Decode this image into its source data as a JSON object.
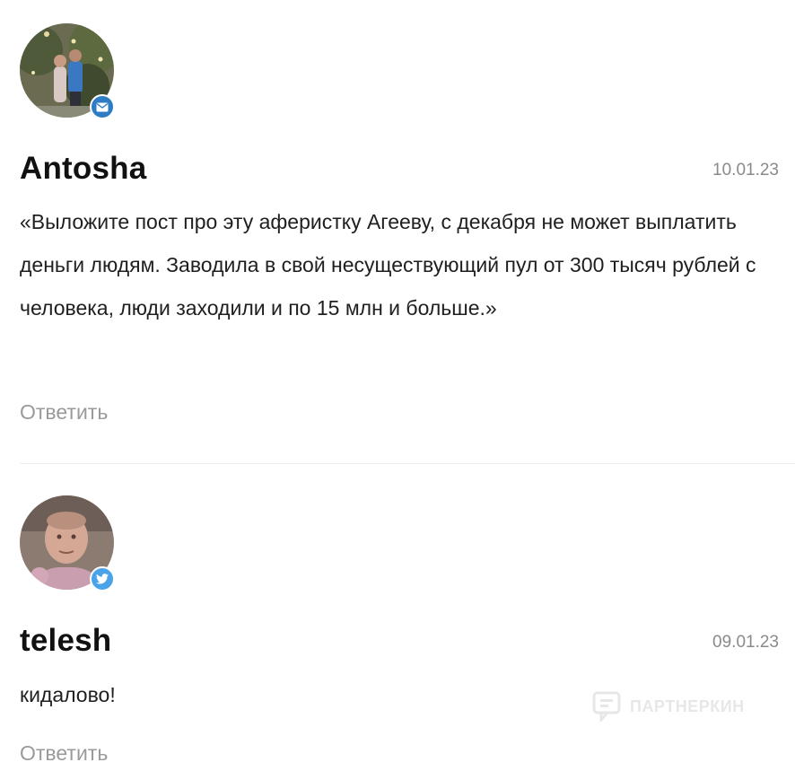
{
  "comments": [
    {
      "author": "Antosha",
      "date": "10.01.23",
      "text": "«Выложите пост про эту аферистку Агееву, с декабря не может выплатить деньги людям. Заводила в свой несуществующий пул от 300 тысяч рублей с человека, люди заходили и по 15 млн и больше.»",
      "reply_label": "Ответить",
      "badge_icon": "mail-icon",
      "badge_color": "#2e7cc4"
    },
    {
      "author": "telesh",
      "date": "09.01.23",
      "text": "кидалово!",
      "reply_label": "Ответить",
      "badge_icon": "twitter-icon",
      "badge_color": "#4aa3e8"
    }
  ],
  "watermark": {
    "text": "ПАРТНЕРКИН",
    "icon": "partnerkin-logo-icon"
  }
}
